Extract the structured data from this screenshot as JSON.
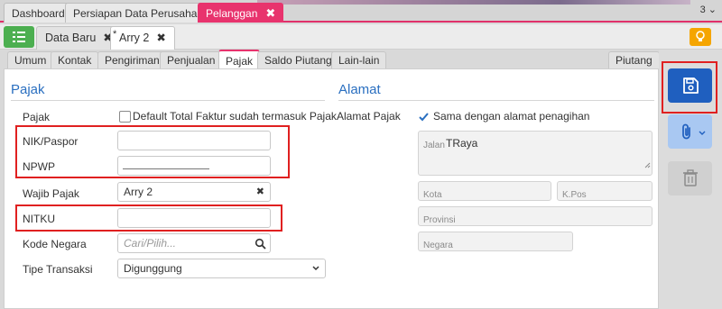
{
  "top_tabs": [
    {
      "label": "Dashboard"
    },
    {
      "label": "Persiapan Data Perusahaan"
    },
    {
      "label": "Pelanggan",
      "close": "✖"
    }
  ],
  "top_right": "3 ⌄",
  "doc_tabs": [
    {
      "label": "Data Baru",
      "close": "✖"
    },
    {
      "label": "Arry 2",
      "close": "✖",
      "star": "*"
    }
  ],
  "sub_tabs": [
    {
      "label": "Umum"
    },
    {
      "label": "Kontak"
    },
    {
      "label": "Pengiriman"
    },
    {
      "label": "Penjualan"
    },
    {
      "label": "Pajak"
    },
    {
      "label": "Saldo Piutang"
    },
    {
      "label": "Lain-lain"
    },
    {
      "label": "Piutang"
    }
  ],
  "pajak": {
    "title": "Pajak",
    "pajak_label": "Pajak",
    "pajak_checkbox_label": "Default Total Faktur sudah termasuk Pajak",
    "nik_label": "NIK/Paspor",
    "nik_value": "",
    "npwp_label": "NPWP",
    "npwp_value": "",
    "wajib_pajak_label": "Wajib Pajak",
    "wajib_pajak_value": "Arry 2",
    "wajib_pajak_clear": "✖",
    "nitku_label": "NITKU",
    "nitku_value": "",
    "kode_negara_label": "Kode Negara",
    "kode_negara_placeholder": "Cari/Pilih...",
    "tipe_transaksi_label": "Tipe Transaksi",
    "tipe_transaksi_value": "Digunggung"
  },
  "alamat": {
    "title": "Alamat",
    "alamat_pajak_label": "Alamat Pajak",
    "same_address_label": "Sama dengan alamat penagihan",
    "jalan_label": "Jalan",
    "jalan_value": "TRaya",
    "kota_label": "Kota",
    "kpos_label": "K.Pos",
    "provinsi_label": "Provinsi",
    "negara_label": "Negara"
  },
  "colors": {
    "accent": "#e8336d",
    "primary": "#1f5fbf",
    "success": "#4caf50",
    "warning": "#f5a500",
    "highlight": "#e02020"
  }
}
